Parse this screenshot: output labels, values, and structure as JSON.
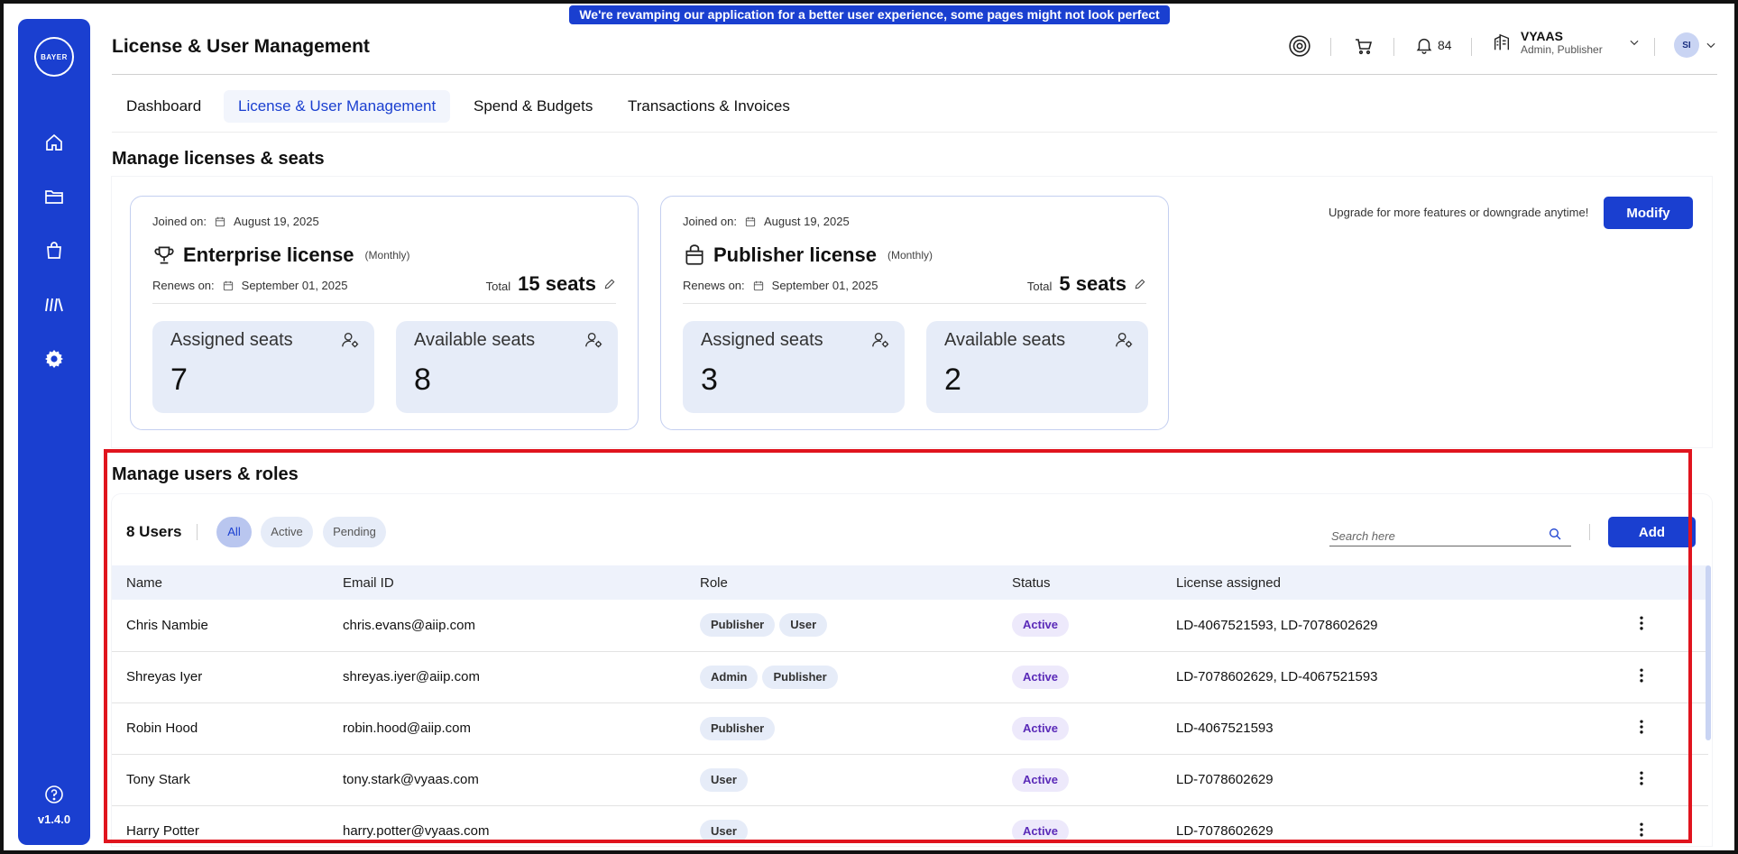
{
  "banner": {
    "text": "We're revamping our application for a better user experience, some pages might not look perfect yet!"
  },
  "sidebar": {
    "logo_text": "BAYER",
    "items": [
      {
        "name": "home-icon"
      },
      {
        "name": "folder-icon"
      },
      {
        "name": "shopping-bag-icon"
      },
      {
        "name": "library-icon"
      },
      {
        "name": "gear-icon"
      }
    ],
    "version": "v1.4.0"
  },
  "header": {
    "title": "License & User Management",
    "notifications_count": "84",
    "org_name": "VYAAS",
    "org_roles": "Admin, Publisher",
    "avatar_initials": "SI"
  },
  "tabs": [
    {
      "label": "Dashboard"
    },
    {
      "label": "License & User Management",
      "active": true
    },
    {
      "label": "Spend & Budgets"
    },
    {
      "label": "Transactions & Invoices"
    }
  ],
  "licenses_section": {
    "title": "Manage licenses & seats",
    "upgrade_text": "Upgrade for more features or downgrade anytime!",
    "modify_label": "Modify",
    "cards": [
      {
        "joined_label": "Joined on:",
        "joined_date": "August 19, 2025",
        "name": "Enterprise license",
        "period": "(Monthly)",
        "renews_label": "Renews on:",
        "renews_date": "September 01, 2025",
        "total_label": "Total",
        "total_seats": "15 seats",
        "assigned_label": "Assigned seats",
        "assigned_value": "7",
        "available_label": "Available seats",
        "available_value": "8"
      },
      {
        "joined_label": "Joined on:",
        "joined_date": "August 19, 2025",
        "name": "Publisher license",
        "period": "(Monthly)",
        "renews_label": "Renews on:",
        "renews_date": "September 01, 2025",
        "total_label": "Total",
        "total_seats": "5 seats",
        "assigned_label": "Assigned seats",
        "assigned_value": "3",
        "available_label": "Available seats",
        "available_value": "2"
      }
    ]
  },
  "users_section": {
    "title": "Manage users & roles",
    "count_label": "8 Users",
    "filters": [
      {
        "label": "All",
        "active": true
      },
      {
        "label": "Active"
      },
      {
        "label": "Pending"
      }
    ],
    "search_placeholder": "Search here",
    "add_label": "Add",
    "columns": [
      "Name",
      "Email ID",
      "Role",
      "Status",
      "License assigned"
    ],
    "rows": [
      {
        "name": "Chris Nambie",
        "email": "chris.evans@aiip.com",
        "roles": [
          "Publisher",
          "User"
        ],
        "status": "Active",
        "license": "LD-4067521593, LD-7078602629"
      },
      {
        "name": "Shreyas Iyer",
        "email": "shreyas.iyer@aiip.com",
        "roles": [
          "Admin",
          "Publisher"
        ],
        "status": "Active",
        "license": "LD-7078602629, LD-4067521593"
      },
      {
        "name": "Robin Hood",
        "email": "robin.hood@aiip.com",
        "roles": [
          "Publisher"
        ],
        "status": "Active",
        "license": "LD-4067521593"
      },
      {
        "name": "Tony Stark",
        "email": "tony.stark@vyaas.com",
        "roles": [
          "User"
        ],
        "status": "Active",
        "license": "LD-7078602629"
      },
      {
        "name": "Harry Potter",
        "email": "harry.potter@vyaas.com",
        "roles": [
          "User"
        ],
        "status": "Active",
        "license": "LD-7078602629"
      }
    ]
  },
  "colors": {
    "brand": "#1a3fd0",
    "highlight": "#e0141e",
    "status_text": "#5a2ab8"
  }
}
